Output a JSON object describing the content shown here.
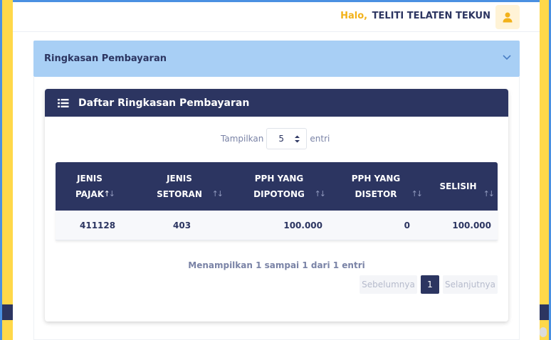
{
  "header": {
    "greeting": "Halo,",
    "user_name": "TELITI TELATEN TEKUN",
    "avatar_icon": "user-icon"
  },
  "summary": {
    "title": "Ringkasan Pembayaran",
    "toggle_icon": "chevron-down-icon"
  },
  "card": {
    "title": "Daftar Ringkasan Pembayaran",
    "icon": "list-icon"
  },
  "length_menu": {
    "prefix": "Tampilkan",
    "value": "5",
    "suffix": "entri"
  },
  "table": {
    "columns": [
      {
        "line1": "JENIS",
        "line2": "PAJAK",
        "sort": "asc"
      },
      {
        "line1": "JENIS",
        "line2": "SETORAN",
        "sort": "none"
      },
      {
        "line1": "PPH YANG",
        "line2": "DIPOTONG",
        "sort": "none"
      },
      {
        "line1": "PPH YANG",
        "line2": "DISETOR",
        "sort": "none"
      },
      {
        "line1": "SELISIH",
        "line2": "",
        "sort": "none"
      }
    ],
    "rows": [
      {
        "jenis_pajak": "411128",
        "jenis_setoran": "403",
        "pph_dipotong": "100.000",
        "pph_disetor": "0",
        "selisih": "100.000"
      }
    ]
  },
  "footer": {
    "info": "Menampilkan 1 sampai 1 dari 1 entri",
    "prev_label": "Sebelumnya",
    "current_page": "1",
    "next_label": "Selanjutnya"
  },
  "colors": {
    "navy": "#2c3561",
    "accent_yellow": "#f2b21a",
    "summary_bg": "#a8cff5"
  }
}
